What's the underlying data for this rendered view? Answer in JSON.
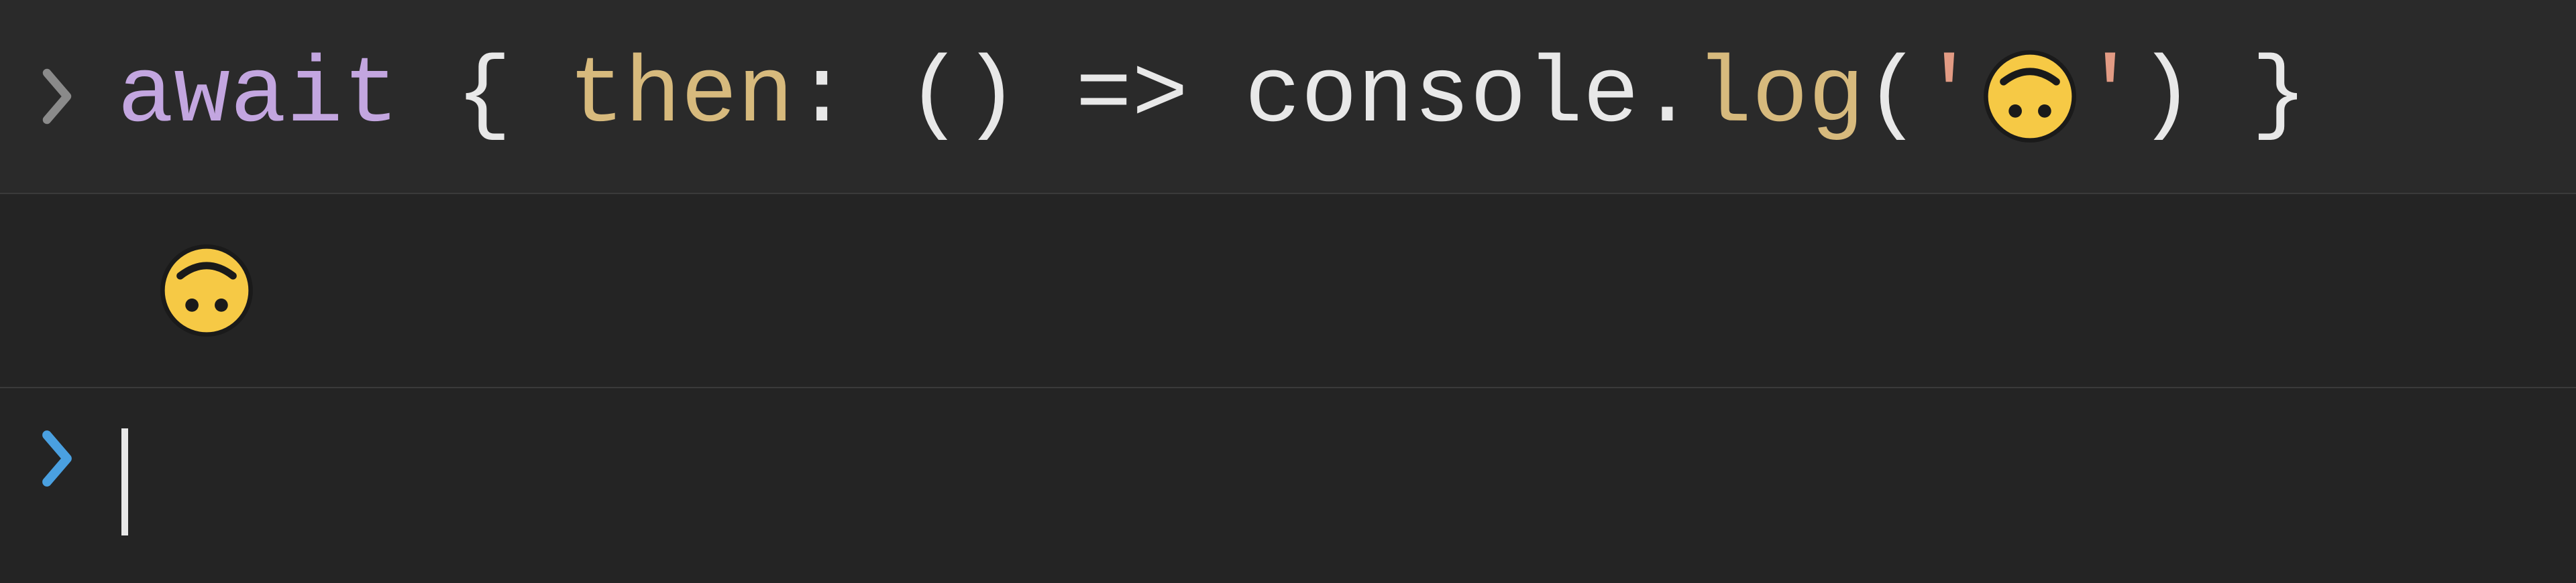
{
  "console": {
    "past": {
      "tokens": {
        "await": "await",
        "space1": " ",
        "lbrace": "{",
        "space2": " ",
        "then": "then",
        "colon": ":",
        "space3": " ",
        "lparen": "(",
        "rparen": ")",
        "space4": " ",
        "arrow": "=>",
        "space5": " ",
        "console": "console",
        "dot": ".",
        "log": "log",
        "lparen2": "(",
        "q1": "'",
        "emoji_name": "upside-down-face",
        "q2": "'",
        "rparen2": ")",
        "space6": " ",
        "rbrace": "}"
      }
    },
    "output": {
      "emoji_name": "upside-down-face"
    },
    "current": {
      "value": ""
    }
  },
  "icons": {
    "chevron_past_color": "#8a8a8a",
    "chevron_current_color": "#4aa0e0"
  }
}
